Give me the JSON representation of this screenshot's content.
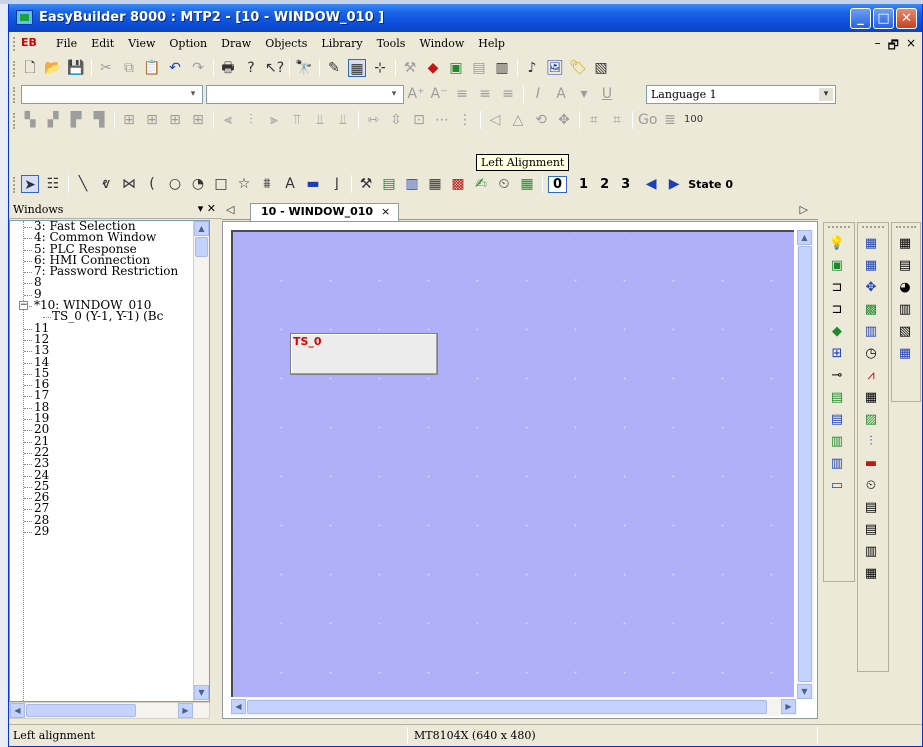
{
  "window": {
    "title": "EasyBuilder 8000 : MTP2 - [10 - WINDOW_010 ]",
    "min_label": "_",
    "max_label": "□",
    "close_label": "✕"
  },
  "menu": {
    "logo": "EB",
    "items": [
      "File",
      "Edit",
      "View",
      "Option",
      "Draw",
      "Objects",
      "Library",
      "Tools",
      "Window",
      "Help"
    ],
    "mdi_min": "–",
    "mdi_restore": "🗗",
    "mdi_close": "×"
  },
  "format_bar": {
    "language": "Language 1"
  },
  "align_bar": {
    "zoom": "100"
  },
  "tooltip": "Left Alignment",
  "draw_bar": {
    "states": [
      "0",
      "1",
      "2",
      "3"
    ],
    "state_label": "State 0"
  },
  "panel": {
    "title": "Windows",
    "controls": "▾ ✕",
    "items": [
      {
        "label": "3: Fast Selection"
      },
      {
        "label": "4: Common Window"
      },
      {
        "label": "5: PLC Response"
      },
      {
        "label": "6: HMI Connection"
      },
      {
        "label": "7: Password Restriction"
      },
      {
        "label": "8"
      },
      {
        "label": "9"
      },
      {
        "label": "*10: WINDOW_010",
        "expanded": true
      },
      {
        "label": "TS_0 (Y-1, Y-1) (Bc",
        "child": true
      },
      {
        "label": "11"
      },
      {
        "label": "12"
      },
      {
        "label": "13"
      },
      {
        "label": "14"
      },
      {
        "label": "15"
      },
      {
        "label": "16"
      },
      {
        "label": "17"
      },
      {
        "label": "18"
      },
      {
        "label": "19"
      },
      {
        "label": "20"
      },
      {
        "label": "21"
      },
      {
        "label": "22"
      },
      {
        "label": "23"
      },
      {
        "label": "24"
      },
      {
        "label": "25"
      },
      {
        "label": "26"
      },
      {
        "label": "27"
      },
      {
        "label": "28"
      },
      {
        "label": "29"
      }
    ]
  },
  "tabs": {
    "active": "10 - WINDOW_010",
    "close": "×"
  },
  "canvas": {
    "object_label": "TS_0",
    "background": "#b0b0f8"
  },
  "status": {
    "left": "Left alignment",
    "model": "MT8104X (640 x 480)"
  },
  "colors": {
    "titlebar": "#0b4fd8",
    "accent_red": "#e00000"
  }
}
